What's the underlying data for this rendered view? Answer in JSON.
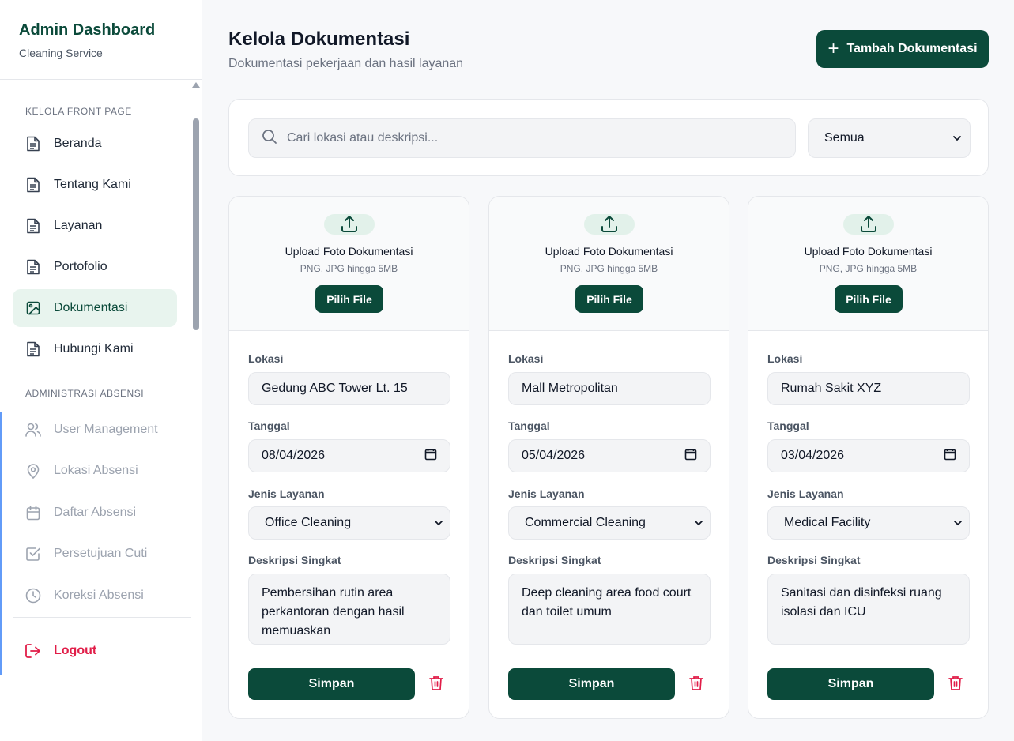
{
  "sidebar": {
    "title": "Admin Dashboard",
    "subtitle": "Cleaning Service",
    "section_front": "KELOLA FRONT PAGE",
    "front_items": [
      {
        "label": "Beranda",
        "icon": "document-icon"
      },
      {
        "label": "Tentang Kami",
        "icon": "document-icon"
      },
      {
        "label": "Layanan",
        "icon": "document-icon"
      },
      {
        "label": "Portofolio",
        "icon": "document-icon"
      },
      {
        "label": "Dokumentasi",
        "icon": "image-icon"
      },
      {
        "label": "Hubungi Kami",
        "icon": "document-icon"
      }
    ],
    "section_admin": "ADMINISTRASI ABSENSI",
    "admin_items": [
      {
        "label": "User Management",
        "icon": "users-icon"
      },
      {
        "label": "Lokasi Absensi",
        "icon": "map-pin-icon"
      },
      {
        "label": "Daftar Absensi",
        "icon": "calendar-icon"
      },
      {
        "label": "Persetujuan Cuti",
        "icon": "checkbox-icon"
      },
      {
        "label": "Koreksi Absensi",
        "icon": "clock-icon"
      }
    ],
    "logout": "Logout"
  },
  "header": {
    "title": "Kelola Dokumentasi",
    "subtitle": "Dokumentasi pekerjaan dan hasil layanan",
    "add_button": "Tambah Dokumentasi"
  },
  "filter": {
    "search_placeholder": "Cari lokasi atau deskripsi...",
    "select_value": "Semua"
  },
  "card_labels": {
    "upload_title": "Upload Foto Dokumentasi",
    "upload_hint": "PNG, JPG hingga 5MB",
    "pick_file": "Pilih File",
    "lokasi": "Lokasi",
    "tanggal": "Tanggal",
    "jenis": "Jenis Layanan",
    "deskripsi": "Deskripsi Singkat",
    "save": "Simpan"
  },
  "cards": [
    {
      "lokasi": "Gedung ABC Tower Lt. 15",
      "tanggal": "08/04/2026",
      "jenis": "Office Cleaning",
      "deskripsi": "Pembersihan rutin area perkantoran dengan hasil memuaskan"
    },
    {
      "lokasi": "Mall Metropolitan",
      "tanggal": "05/04/2026",
      "jenis": "Commercial Cleaning",
      "deskripsi": "Deep cleaning area food court dan toilet umum"
    },
    {
      "lokasi": "Rumah Sakit XYZ",
      "tanggal": "03/04/2026",
      "jenis": "Medical Facility",
      "deskripsi": "Sanitasi dan disinfeksi ruang isolasi dan ICU"
    }
  ],
  "colors": {
    "primary": "#0b4a3a",
    "active_bg": "#e8f4ee",
    "danger": "#e11d48"
  }
}
